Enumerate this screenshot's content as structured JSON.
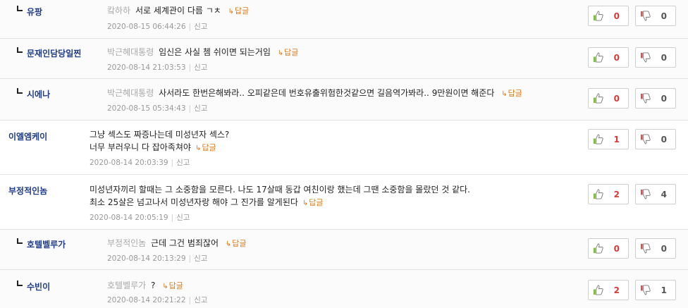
{
  "comments": [
    {
      "nick": "유팡",
      "target": "캌하하",
      "text": "서로 세계관이 다름 ㄱㅊ",
      "reply_label": "답글",
      "date": "2020-08-15 06:44:26",
      "report": "신고",
      "likes": "0",
      "dislikes": "0"
    },
    {
      "nick": "문재인담당일찐",
      "target": "박근혜대통령",
      "text": "임신은 사실 쳄 쉬이면 되는거임",
      "reply_label": "답글",
      "date": "2020-08-14 21:03:53",
      "report": "신고",
      "likes": "0",
      "dislikes": "0"
    },
    {
      "nick": "시에나",
      "target": "박근혜대통령",
      "text": "사서라도 한번은해봐라.. 오피같은데 번호유출위험한것같으면 길음역가봐라.. 9만원이면 해준다",
      "reply_label": "답글",
      "date": "2020-08-15 05:34:43",
      "report": "신고",
      "likes": "0",
      "dislikes": "0"
    },
    {
      "nick": "이엘엠케이",
      "line1": "그냥 섹스도 짜증나는데 미성년자 섹스?",
      "line2": "너무 부러우니 다 잡아족쳐야",
      "reply_label": "답글",
      "date": "2020-08-14 20:03:39",
      "report": "신고",
      "likes": "1",
      "dislikes": "0"
    },
    {
      "nick": "부정적인놈",
      "line1": "미성년자끼리 할때는 그 소중함을 모른다. 나도 17살때 동갑 여친이랑 했는데 그땐 소중함을 몰랐던 것 같다.",
      "line2": "최소 25살은 넘고나서 미성년자랑 해야 그 진가를 알게된다",
      "reply_label": "답글",
      "date": "2020-08-14 20:05:19",
      "report": "신고",
      "likes": "2",
      "dislikes": "4"
    },
    {
      "nick": "호텔벨루가",
      "target": "부정적인놈",
      "text": "근데 그건 범죄잖어",
      "reply_label": "답글",
      "date": "2020-08-14 20:13:29",
      "report": "신고",
      "likes": "0",
      "dislikes": "0"
    },
    {
      "nick": "수빈이",
      "target": "호텔벨루가",
      "text": "?",
      "reply_label": "답글",
      "date": "2020-08-14 20:21:22",
      "report": "신고",
      "likes": "2",
      "dislikes": "1"
    }
  ],
  "colors": {
    "accent": "#1f3c88",
    "reply_link": "#d77a1a",
    "like_count": "#d83a3a",
    "thumb_up": "#7dbb3c",
    "thumb_down": "#d9534f"
  },
  "icons": {
    "like": "thumbs-up-icon",
    "dislike": "thumbs-down-icon",
    "reply_arrow": "reply-arrow-icon"
  }
}
